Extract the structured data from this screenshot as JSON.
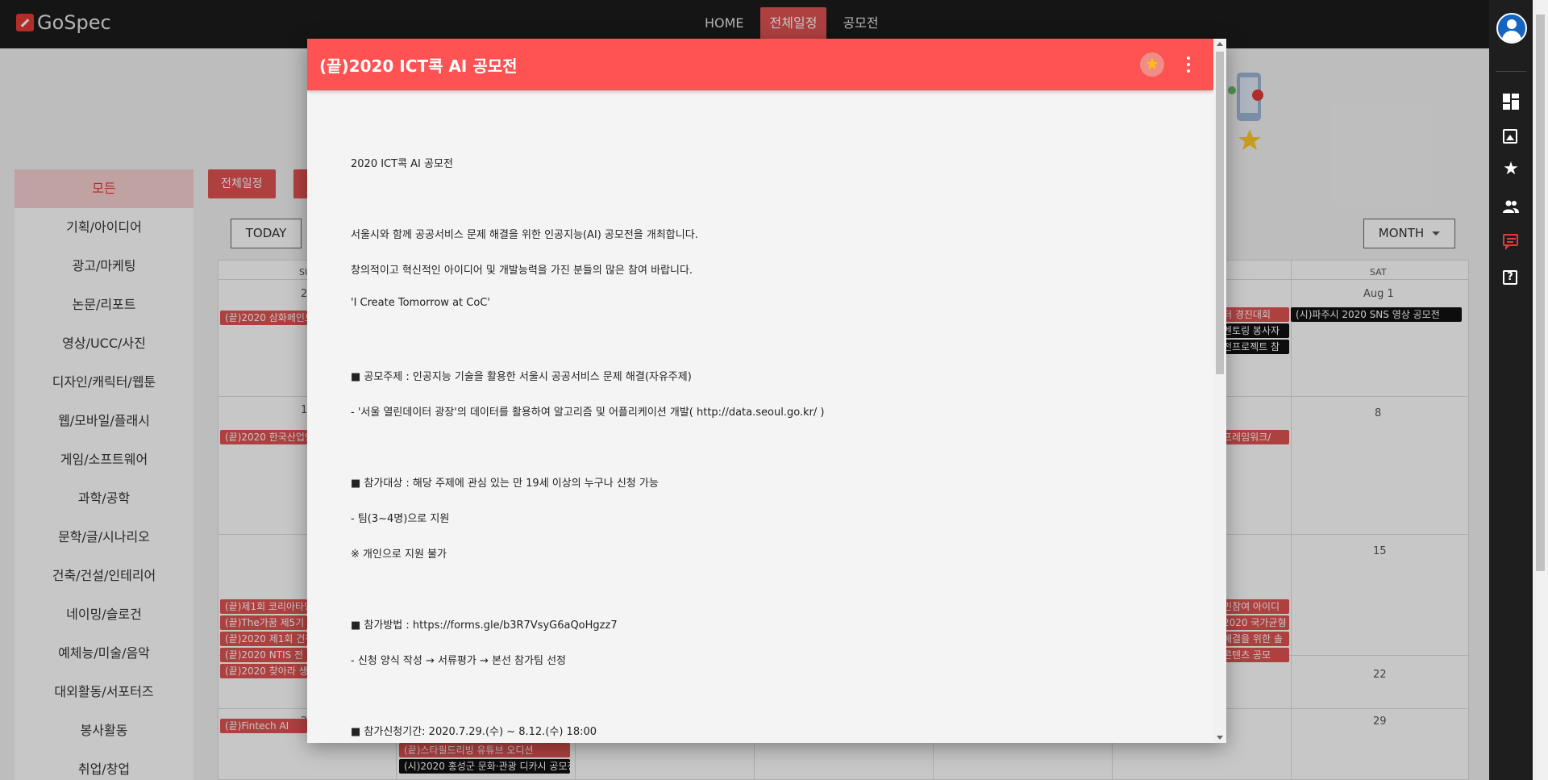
{
  "app": {
    "logo_text": "GoSpec"
  },
  "nav": [
    {
      "label": "HOME",
      "active": false
    },
    {
      "label": "전체일정",
      "active": true
    },
    {
      "label": "공모전",
      "active": false
    }
  ],
  "rail": {
    "icons": [
      "account-icon",
      "dashboard-icon",
      "image-icon",
      "star-icon",
      "people-icon",
      "chat-icon",
      "help-icon"
    ]
  },
  "background": {
    "categories": [
      "모든",
      "기획/아이디어",
      "광고/마케팅",
      "논문/리포트",
      "영상/UCC/사진",
      "디자인/캐릭터/웹툰",
      "웹/모바일/플래시",
      "게임/소프트웨어",
      "과학/공학",
      "문학/글/시나리오",
      "건축/건설/인테리어",
      "네이밍/슬로건",
      "예체능/미술/음악",
      "대외활동/서포터즈",
      "봉사활동",
      "취업/창업"
    ],
    "filter_button": "전체일정",
    "today_button": "TODAY",
    "month_button": "MONTH",
    "weekday_partial": "SU",
    "weekday_sat": "SAT",
    "days": [
      "2",
      "8",
      "15",
      "22",
      "29",
      "Aug 1",
      "1",
      "2"
    ],
    "events": [
      "(끝)2020 삼화페인트",
      "(끝)2020 한국산업인",
      "(끝)제1회 코리아타인",
      "(끝)The가꿈 제5기 대",
      "(끝)2020 제1회 건전",
      "(끝)2020 NTIS 전",
      "(끝)2020 찾아라 생활",
      "(끝)Fintech AI",
      "(끝)스타필드리빙 유튜브 오디션",
      "(시)2020 홍성군 문화·관광 디카시 공모전",
      "(시)파주시 2020 SNS 영상 공모전",
      "터 경진대회",
      "멘토링 봉사자",
      "전프로젝트 참",
      "프레임워크/",
      "민참여 아이디",
      "2020 국가균형",
      "해결을 위한 솔",
      "콘텐츠 공모"
    ]
  },
  "modal": {
    "title": "(끝)2020 ICT콕 AI 공모전",
    "paragraphs": [
      "2020 ICT콕 AI 공모전",
      "서울시와 함께 공공서비스 문제 해결을 위한 인공지능(AI) 공모전을 개최합니다.",
      "창의적이고 혁신적인 아이디어 및 개발능력을 가진 분들의 많은 참여 바랍니다.",
      "'I Create Tomorrow at CoC'",
      "■ 공모주제 : 인공지능 기술을 활용한 서울시 공공서비스 문제 해결(자유주제)",
      "- '서울 열린데이터 광장'의 데이터를 활용하여 알고리즘 및 어플리케이션 개발( http://data.seoul.go.kr/ )",
      "■ 참가대상 : 해당 주제에 관심 있는 만 19세 이상의 누구나 신청 가능",
      "- 팀(3~4명)으로 지원",
      "※ 개인으로 지원 불가",
      "■ 참가방법 : https://forms.gle/b3R7VsyG6aQoHgzz7",
      "- 신청 양식 작성 → 서류평가 → 본선 참가팀 선정",
      "■ 참가신청기간: 2020.7.29.(수) ~ 8.12.(수) 18:00"
    ]
  },
  "colors": {
    "accent": "#ff5252",
    "topbar": "#1b1b1b",
    "rail": "#1e1e1e",
    "star": "#ffc107"
  }
}
